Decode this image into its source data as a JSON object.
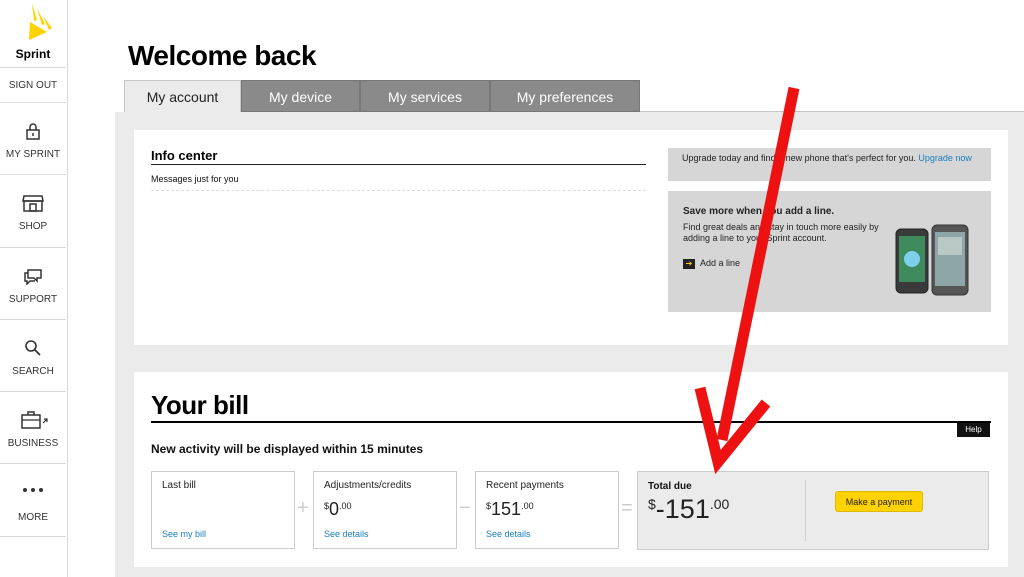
{
  "brand": {
    "logo_text": "Sprint",
    "accent": "#ffd200"
  },
  "sidebar": {
    "sign_out": "SIGN OUT",
    "items": [
      {
        "label": "MY SPRINT",
        "icon": "lock-icon"
      },
      {
        "label": "SHOP",
        "icon": "store-icon"
      },
      {
        "label": "SUPPORT",
        "icon": "chat-icon"
      },
      {
        "label": "SEARCH",
        "icon": "search-icon"
      },
      {
        "label": "BUSINESS",
        "icon": "briefcase-icon"
      },
      {
        "label": "MORE",
        "icon": "more-icon"
      }
    ]
  },
  "header": {
    "title": "Welcome back"
  },
  "tabs": [
    {
      "label": "My account",
      "active": true
    },
    {
      "label": "My device",
      "active": false
    },
    {
      "label": "My services",
      "active": false
    },
    {
      "label": "My preferences",
      "active": false
    }
  ],
  "info_center": {
    "title": "Info center",
    "message": "Messages just for you"
  },
  "promo_upgrade": {
    "text": "Upgrade today and find a new phone that's perfect for you.",
    "link": "Upgrade now"
  },
  "promo_line": {
    "title": "Save more when you add a line.",
    "desc": "Find great deals and stay in touch more easily by adding a line to your Sprint account.",
    "link": "Add a line"
  },
  "bill": {
    "title": "Your bill",
    "help": "Help",
    "note": "New activity will be displayed within 15 minutes",
    "last_bill": {
      "label": "Last bill",
      "link": "See my bill"
    },
    "adjustments": {
      "label": "Adjustments/credits",
      "dollars": "0",
      "cents": ".00",
      "link": "See details"
    },
    "payments": {
      "label": "Recent payments",
      "dollars": "151",
      "cents": ".00",
      "link": "See details"
    },
    "total": {
      "label": "Total due",
      "dollars": "-151",
      "cents": ".00",
      "button": "Make a payment"
    },
    "currency": "$",
    "ops": {
      "plus": "+",
      "minus": "−",
      "equals": "="
    }
  },
  "annotation_color": "#ee1111"
}
